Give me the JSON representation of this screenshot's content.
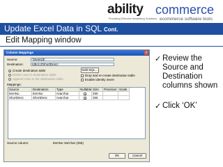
{
  "logo": {
    "brand_a": "ability",
    "tagline": "Providing Effective Marketing Solutions",
    "brand_b": "commerce",
    "sub": "ecommerce software tools"
  },
  "header": {
    "title": "Update Excel Data in SQL",
    "cont": "Cont."
  },
  "subtitle": "Edit Mapping window",
  "dialog": {
    "title": "Column Mappings",
    "close_icon": "close-icon",
    "source_label": "Source:",
    "source_value": "'Sheet1$'",
    "destination_label": "Destination:",
    "destination_value": "[dbo].[ZShortDesc]",
    "options": {
      "create_table": "Create destination table",
      "delete_rows": "Delete rows in destination table",
      "append_rows": "Append rows to the destination table",
      "drop_recreate": "Drop and re-create destination table",
      "enable_identity": "Enable identity insert"
    },
    "edit_sql_label": "Edit SQL...",
    "mappings_label": "Mappings:",
    "grid": {
      "headers": [
        "Source",
        "Destination",
        "Type",
        "Nullable",
        "Size",
        "Precision",
        "Scale"
      ],
      "rows": [
        [
          "ItemNo",
          "ItemNo",
          "nvarchar",
          "",
          "255",
          "",
          ""
        ],
        [
          "ShortDesc",
          "ShortDesc",
          "nvarchar",
          "",
          "255",
          "",
          ""
        ]
      ]
    },
    "source_column_label": "Source column:",
    "source_column_value": "ItemNo VarChar (255)",
    "ok_label": "OK",
    "cancel_label": "Cancel"
  },
  "bullets": [
    {
      "icon": "checkmark-icon",
      "text": "Review the Source and Destination columns shown"
    },
    {
      "icon": "checkmark-icon",
      "text": "Click ‘OK’"
    }
  ]
}
